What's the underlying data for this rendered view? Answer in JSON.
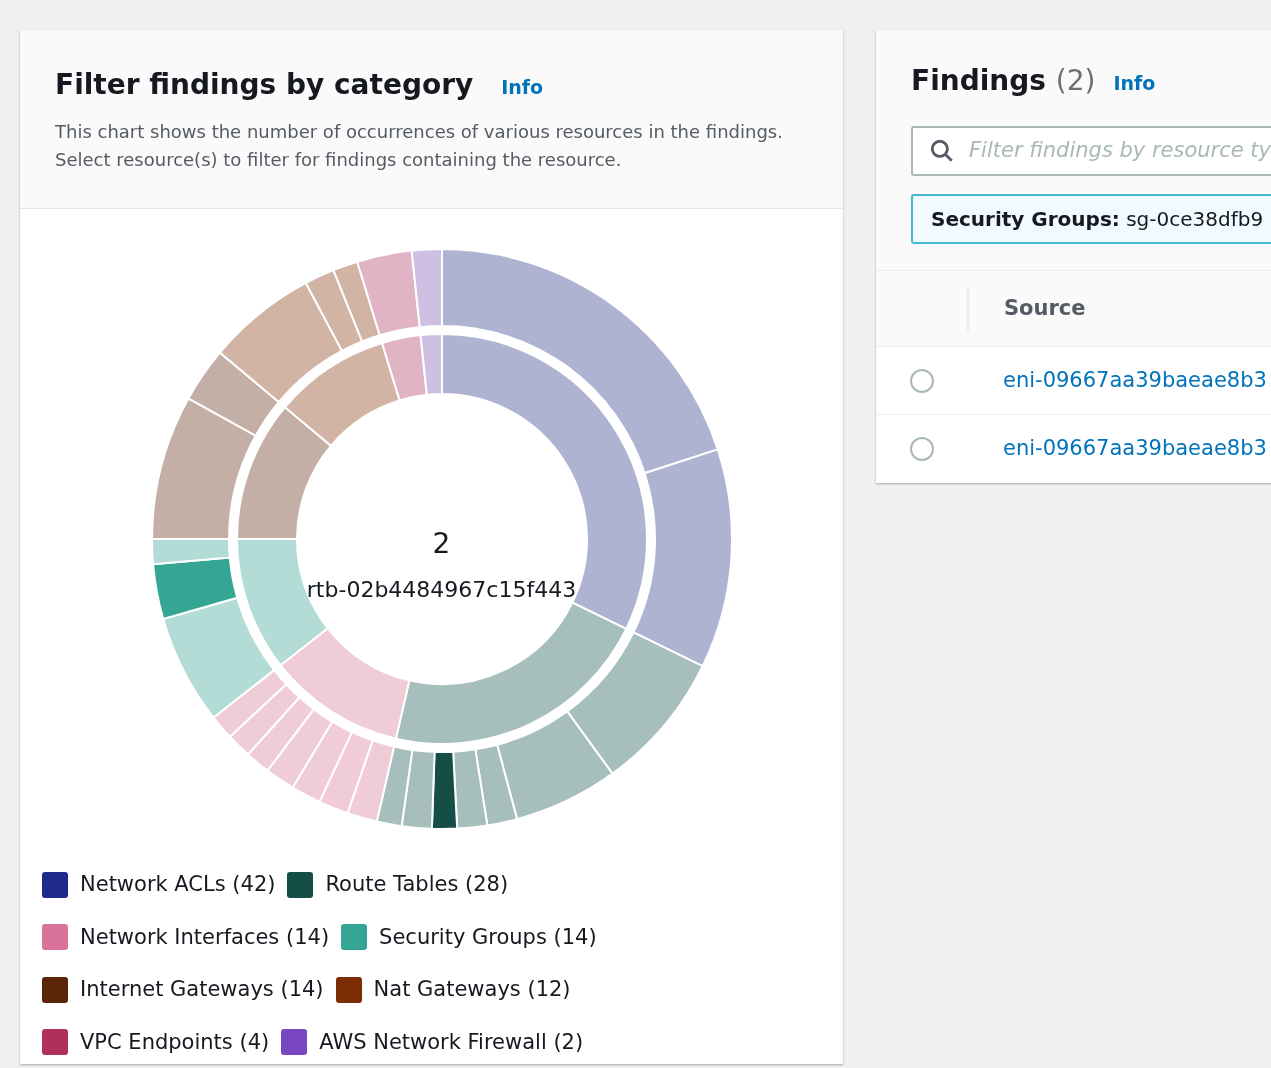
{
  "category_panel": {
    "title": "Filter findings by category",
    "info_link": "Info",
    "description": "This chart shows the number of occurrences of various resources in the findings. Select resource(s) to filter for findings containing the resource.",
    "sunburst": {
      "kind": "picture",
      "center_value": "2",
      "center_label": "rtb-02b4484967c15f443"
    },
    "legend": [
      {
        "label": "Network ACLs (42)",
        "color": "#1f2a8a"
      },
      {
        "label": "Route Tables (28)",
        "color": "#154e47"
      },
      {
        "label": "Network Interfaces (14)",
        "color": "#d9739b"
      },
      {
        "label": "Security Groups (14)",
        "color": "#35a594"
      },
      {
        "label": "Internet Gateways (14)",
        "color": "#5a2509"
      },
      {
        "label": "Nat Gateways (12)",
        "color": "#7c2e02"
      },
      {
        "label": "VPC Endpoints (4)",
        "color": "#b0305d"
      },
      {
        "label": "AWS Network Firewall (2)",
        "color": "#7846c1"
      }
    ]
  },
  "findings_panel": {
    "title": "Findings",
    "count": "(2)",
    "info_link": "Info",
    "search": {
      "placeholder": "Filter findings by resource ty"
    },
    "filter_token": {
      "key": "Security Groups:",
      "value": "sg-0ce38dfb9"
    },
    "table": {
      "columns": [
        "Source"
      ],
      "rows": [
        {
          "selected": false,
          "source": "eni-09667aa39baeae8b3"
        },
        {
          "selected": false,
          "source": "eni-09667aa39baeae8b3"
        }
      ]
    }
  }
}
